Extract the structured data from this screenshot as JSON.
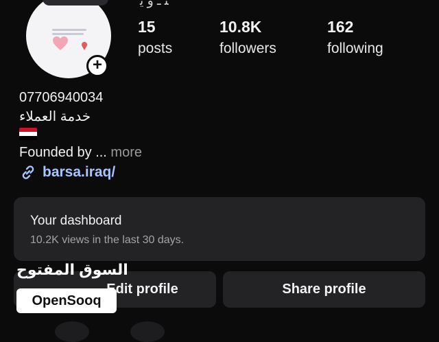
{
  "header_cut_text": "ﻨ ـ ﻭ ﻳ",
  "avatar": {
    "heading": "#SBsoqehiba",
    "subheading": "الجالية العراقية للحصات التوصيل"
  },
  "stats": {
    "posts": {
      "value": "15",
      "label": "posts"
    },
    "followers": {
      "value": "10.8K",
      "label": "followers"
    },
    "following": {
      "value": "162",
      "label": "following"
    }
  },
  "bio": {
    "phone": "07706940034",
    "arabic_line": "خدمة العملاء",
    "flag": "iraq-flag",
    "founded_text": "Founded by ...",
    "more_label": " more",
    "link": "barsa.iraq/"
  },
  "dashboard": {
    "title": "Your dashboard",
    "subtitle": "10.2K views in the last 30 days."
  },
  "buttons": {
    "edit_profile": "Edit profile",
    "share_profile": "Share profile"
  },
  "watermark": {
    "arabic": "السوق المفتوح",
    "latin": "OpenSooq"
  },
  "colors": {
    "background": "#0b0b0c",
    "card": "#232326",
    "link": "#a9c4ff"
  }
}
